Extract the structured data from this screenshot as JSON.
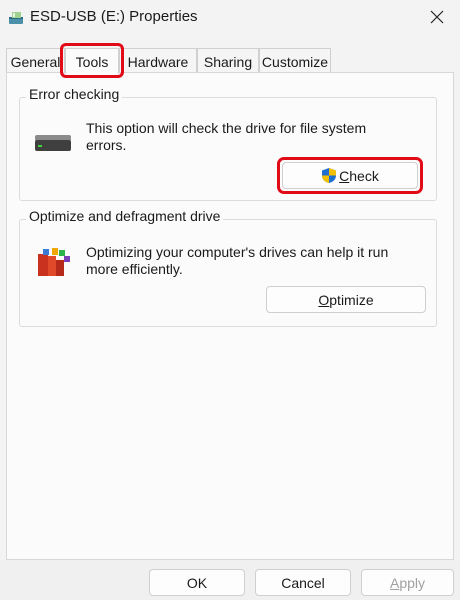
{
  "window": {
    "title": "ESD-USB (E:) Properties",
    "icon": "drive-properties-icon"
  },
  "tabs": [
    {
      "label": "General",
      "active": false
    },
    {
      "label": "Tools",
      "active": true
    },
    {
      "label": "Hardware",
      "active": false
    },
    {
      "label": "Sharing",
      "active": false
    },
    {
      "label": "Customize",
      "active": false
    }
  ],
  "error_checking": {
    "title": "Error checking",
    "description": "This option will check the drive for file system errors.",
    "button": {
      "first": "C",
      "rest": "heck"
    }
  },
  "optimize": {
    "title": "Optimize and defragment drive",
    "description": "Optimizing your computer's drives can help it run more efficiently.",
    "button": {
      "first": "O",
      "rest": "ptimize"
    }
  },
  "footer": {
    "ok": "OK",
    "cancel": "Cancel",
    "apply_first": "A",
    "apply_rest": "pply"
  },
  "colors": {
    "highlight": "#e10b17",
    "panel": "#fbfbfb"
  }
}
